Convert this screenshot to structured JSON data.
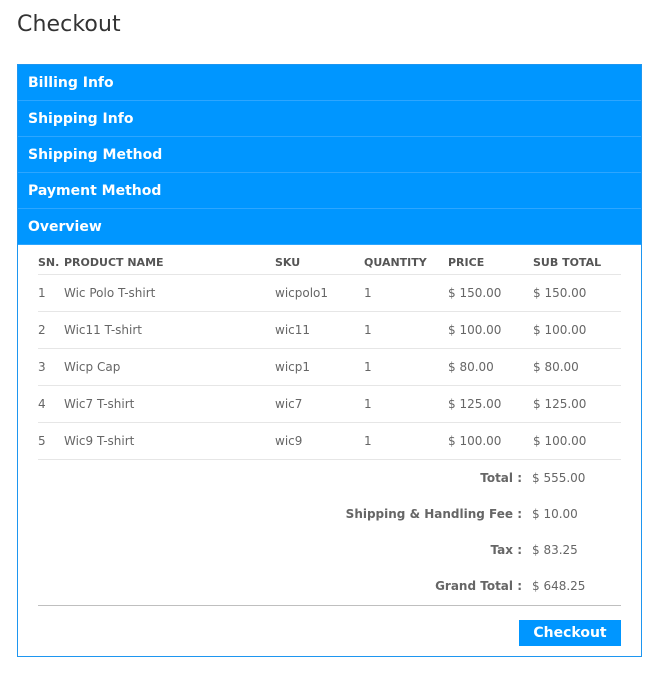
{
  "page": {
    "title": "Checkout"
  },
  "accordion": {
    "sections": [
      {
        "label": "Billing Info"
      },
      {
        "label": "Shipping Info"
      },
      {
        "label": "Shipping Method"
      },
      {
        "label": "Payment Method"
      },
      {
        "label": "Overview"
      }
    ]
  },
  "overview": {
    "columns": [
      "SN.",
      "PRODUCT NAME",
      "SKU",
      "QUANTITY",
      "PRICE",
      "SUB TOTAL"
    ],
    "rows": [
      {
        "sn": "1",
        "name": "Wic Polo T-shirt",
        "sku": "wicpolo1",
        "qty": "1",
        "price": "$ 150.00",
        "subtotal": "$ 150.00"
      },
      {
        "sn": "2",
        "name": "Wic11 T-shirt",
        "sku": "wic11",
        "qty": "1",
        "price": "$ 100.00",
        "subtotal": "$ 100.00"
      },
      {
        "sn": "3",
        "name": "Wicp Cap",
        "sku": "wicp1",
        "qty": "1",
        "price": "$ 80.00",
        "subtotal": "$ 80.00"
      },
      {
        "sn": "4",
        "name": "Wic7 T-shirt",
        "sku": "wic7",
        "qty": "1",
        "price": "$ 125.00",
        "subtotal": "$ 125.00"
      },
      {
        "sn": "5",
        "name": "Wic9 T-shirt",
        "sku": "wic9",
        "qty": "1",
        "price": "$ 100.00",
        "subtotal": "$ 100.00"
      }
    ],
    "totals": [
      {
        "label": "Total :",
        "value": "$ 555.00"
      },
      {
        "label": "Shipping & Handling Fee :",
        "value": "$ 10.00"
      },
      {
        "label": "Tax :",
        "value": "$ 83.25"
      },
      {
        "label": "Grand Total :",
        "value": "$ 648.25"
      }
    ],
    "checkout_label": "Checkout"
  },
  "colors": {
    "accent": "#0096ff",
    "border": "#1e96f0",
    "text": "#555555"
  }
}
